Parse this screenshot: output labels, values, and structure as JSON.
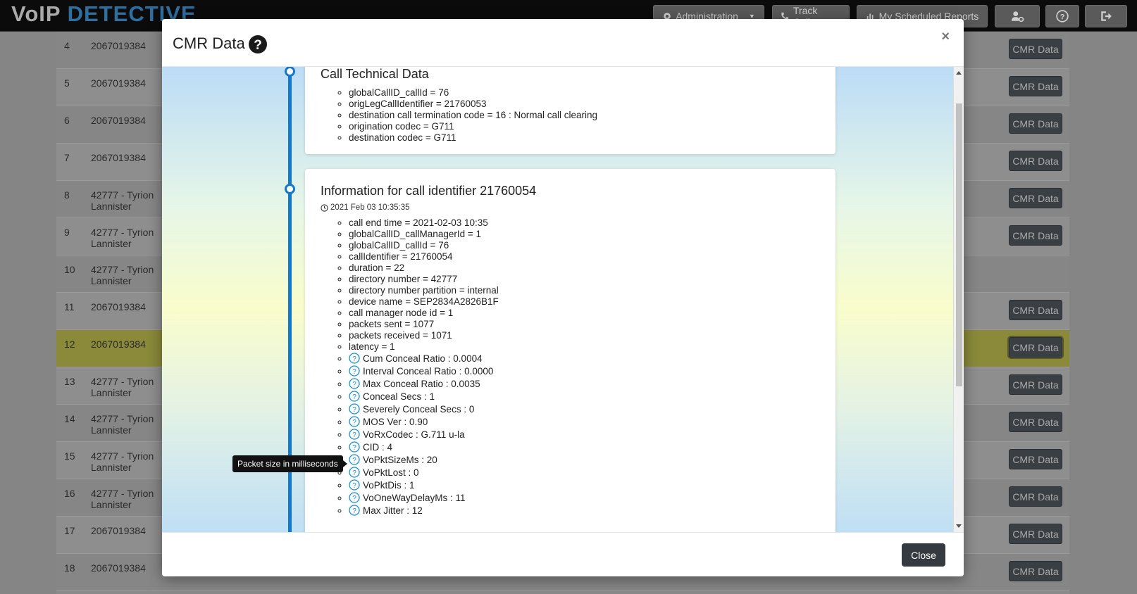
{
  "navbar": {
    "brand_part1": "VoIP",
    "brand_part2": "DETECTIVE",
    "buttons": [
      {
        "label": "Administration",
        "icon": "gears-icon"
      },
      {
        "label": "Track Calls",
        "icon": "phone-icon"
      },
      {
        "label": "My Scheduled Reports",
        "icon": "chart-icon"
      },
      {
        "label": "",
        "icon": "user-gear-icon"
      },
      {
        "label": "",
        "icon": "question-circle-icon"
      },
      {
        "label": "",
        "icon": "sign-out-icon"
      }
    ]
  },
  "background_table": {
    "rows": [
      {
        "num": "4",
        "name": "2067019384",
        "button": "CMR Data"
      },
      {
        "num": "5",
        "name": "2067019384",
        "button": "CMR Data"
      },
      {
        "num": "6",
        "name": "2067019384",
        "button": "CMR Data"
      },
      {
        "num": "7",
        "name": "2067019384",
        "button": "CMR Data"
      },
      {
        "num": "8",
        "name": "42777 - Tyrion Lannister",
        "button": "CMR Data"
      },
      {
        "num": "9",
        "name": "42777 - Tyrion Lannister",
        "button": "CMR Data"
      },
      {
        "num": "10",
        "name": "42777 - Tyrion Lannister",
        "button": ""
      },
      {
        "num": "11",
        "name": "2067019384",
        "button": "CMR Data"
      },
      {
        "num": "12",
        "name": "2067019384",
        "button": "CMR Data"
      },
      {
        "num": "13",
        "name": "42777 - Tyrion Lannister",
        "button": "CMR Data"
      },
      {
        "num": "14",
        "name": "42777 - Tyrion Lannister",
        "button": "CMR Data"
      },
      {
        "num": "15",
        "name": "42777 - Tyrion Lannister",
        "button": "CMR Data"
      },
      {
        "num": "16",
        "name": "42777 - Tyrion Lannister",
        "button": "CMR Data"
      },
      {
        "num": "17",
        "name": "2067019384",
        "button": "CMR Data"
      },
      {
        "num": "18",
        "name": "2067019384",
        "button": "CMR Data"
      }
    ]
  },
  "modal": {
    "title": "CMR Data",
    "close_x": "×",
    "close_button": "Close",
    "card1": {
      "title": "Call Technical Data",
      "items": [
        "globalCallID_callId = 76",
        "origLegCallIdentifier = 21760053",
        "destination call termination code = 16 : Normal call clearing",
        "origination codec = G711",
        "destination codec = G711"
      ]
    },
    "card2": {
      "title": "Information for call identifier 21760054",
      "timestamp": "2021 Feb 03 10:35:35",
      "items": [
        "call end time = 2021-02-03 10:35",
        "globalCallID_callManagerId = 1",
        "globalCallID_callId = 76",
        "callIdentifier = 21760054",
        "duration = 22",
        "directory number = 42777",
        "directory number partition = internal",
        "device name = SEP2834A2826B1F",
        "call manager node id = 1",
        "packets sent = 1077",
        "packets received = 1071",
        "latency = 1"
      ],
      "help_items": [
        "Cum Conceal Ratio : 0.0004",
        "Interval Conceal Ratio : 0.0000",
        "Max Conceal Ratio : 0.0035",
        "Conceal Secs : 1",
        "Severely Conceal Secs : 0",
        "MOS Ver : 0.90",
        "VoRxCodec : G.711 u-la",
        "CID : 4",
        "VoPktSizeMs : 20",
        "VoPktLost : 0",
        "VoPktDis : 1",
        "VoOneWayDelayMs : 11",
        "Max Jitter : 12"
      ]
    },
    "tooltip": "Packet size in milliseconds"
  },
  "colors": {
    "timeline": "#1578c9",
    "button_dark": "#343a40"
  }
}
